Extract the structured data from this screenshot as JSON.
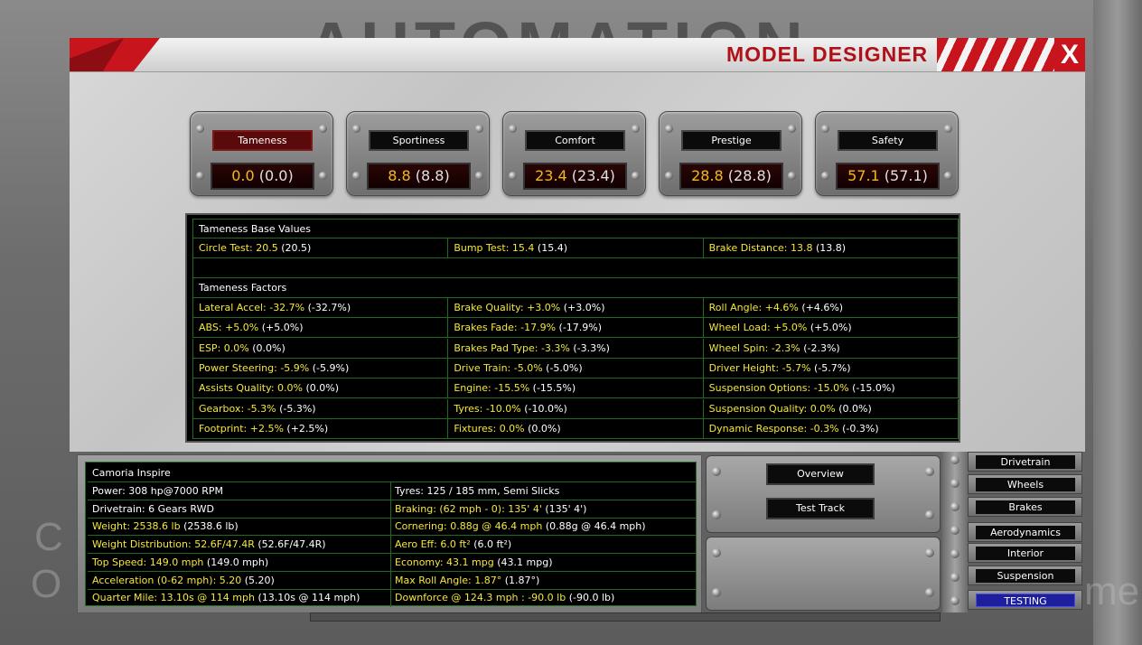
{
  "header": {
    "title": "MODEL DESIGNER",
    "close_label": "X"
  },
  "gauges": [
    {
      "name": "Tameness",
      "value": "0.0",
      "paren": "(0.0)"
    },
    {
      "name": "Sportiness",
      "value": "8.8",
      "paren": "(8.8)"
    },
    {
      "name": "Comfort",
      "value": "23.4",
      "paren": "(23.4)"
    },
    {
      "name": "Prestige",
      "value": "28.8",
      "paren": "(28.8)"
    },
    {
      "name": "Safety",
      "value": "57.1",
      "paren": "(57.1)"
    }
  ],
  "base": {
    "title": "Tameness Base Values",
    "items": [
      {
        "label": "Circle Test: 20.5",
        "paren": "(20.5)"
      },
      {
        "label": "Bump Test: 15.4",
        "paren": "(15.4)"
      },
      {
        "label": "Brake Distance: 13.8",
        "paren": "(13.8)"
      }
    ]
  },
  "factors": {
    "title": "Tameness Factors",
    "rows": [
      [
        {
          "label": "Lateral Accel: -32.7%",
          "paren": "(-32.7%)"
        },
        {
          "label": "Brake Quality: +3.0%",
          "paren": "(+3.0%)"
        },
        {
          "label": "Roll Angle: +4.6%",
          "paren": "(+4.6%)"
        }
      ],
      [
        {
          "label": "ABS: +5.0%",
          "paren": "(+5.0%)"
        },
        {
          "label": "Brakes Fade: -17.9%",
          "paren": "(-17.9%)"
        },
        {
          "label": "Wheel Load: +5.0%",
          "paren": "(+5.0%)"
        }
      ],
      [
        {
          "label": "ESP: 0.0%",
          "paren": "(0.0%)"
        },
        {
          "label": "Brakes Pad Type: -3.3%",
          "paren": "(-3.3%)"
        },
        {
          "label": "Wheel Spin: -2.3%",
          "paren": "(-2.3%)"
        }
      ],
      [
        {
          "label": "Power Steering: -5.9%",
          "paren": "(-5.9%)"
        },
        {
          "label": "Drive Train: -5.0%",
          "paren": "(-5.0%)"
        },
        {
          "label": "Driver Height: -5.7%",
          "paren": "(-5.7%)"
        }
      ],
      [
        {
          "label": "Assists Quality: 0.0%",
          "paren": "(0.0%)"
        },
        {
          "label": "Engine: -15.5%",
          "paren": "(-15.5%)"
        },
        {
          "label": "Suspension Options: -15.0%",
          "paren": "(-15.0%)"
        }
      ],
      [
        {
          "label": "Gearbox: -5.3%",
          "paren": "(-5.3%)"
        },
        {
          "label": "Tyres: -10.0%",
          "paren": "(-10.0%)"
        },
        {
          "label": "Suspension Quality: 0.0%",
          "paren": "(0.0%)"
        }
      ],
      [
        {
          "label": "Footprint: +2.5%",
          "paren": "(+2.5%)"
        },
        {
          "label": "Fixtures: 0.0%",
          "paren": "(0.0%)"
        },
        {
          "label": "Dynamic Response: -0.3%",
          "paren": "(-0.3%)"
        }
      ]
    ]
  },
  "car": {
    "name": "Camoria Inspire",
    "rows": [
      {
        "l": "Power: 308 hp@7000 RPM",
        "lp": "",
        "r": "Tyres: 125 / 185 mm, Semi Slicks",
        "rp": "",
        "lcolor": "w",
        "rcolor": "w"
      },
      {
        "l": "Drivetrain: 6 Gears RWD",
        "lp": "",
        "r": "Braking: (62 mph - 0): 135' 4'",
        "rp": "(135' 4')",
        "lcolor": "w",
        "rcolor": "y"
      },
      {
        "l": "Weight: 2538.6 lb",
        "lp": "(2538.6 lb)",
        "r": "Cornering: 0.88g @ 46.4 mph",
        "rp": "(0.88g @ 46.4 mph)",
        "lcolor": "y",
        "rcolor": "y"
      },
      {
        "l": "Weight Distribution: 52.6F/47.4R",
        "lp": "(52.6F/47.4R)",
        "r": "Aero Eff: 6.0 ft²",
        "rp": "(6.0 ft²)",
        "lcolor": "y",
        "rcolor": "y"
      },
      {
        "l": "Top Speed: 149.0 mph",
        "lp": "(149.0 mph)",
        "r": "Economy: 43.1 mpg",
        "rp": "(43.1 mpg)",
        "lcolor": "y",
        "rcolor": "y"
      },
      {
        "l": "Acceleration (0-62 mph): 5.20",
        "lp": "(5.20)",
        "r": "Max Roll Angle: 1.87°",
        "rp": "(1.87°)",
        "lcolor": "y",
        "rcolor": "y"
      },
      {
        "l": "Quarter Mile: 13.10s @ 114 mph",
        "lp": "(13.10s @ 114 mph)",
        "r": "Downforce @ 124.3 mph : -90.0 lb",
        "rp": "(-90.0 lb)",
        "lcolor": "y",
        "rcolor": "y"
      }
    ]
  },
  "buttons": {
    "overview": "Overview",
    "test_track": "Test Track"
  },
  "nav": [
    "Drivetrain",
    "Wheels",
    "Brakes",
    "Aerodynamics",
    "Interior",
    "Suspension",
    "TESTING"
  ],
  "colors": {
    "accent_red": "#c8141c",
    "value_gold": "#f5b81b",
    "label_yellow": "#f3e83a",
    "grid_green": "#1f6b1f",
    "active_blue": "#1e1f9c"
  }
}
